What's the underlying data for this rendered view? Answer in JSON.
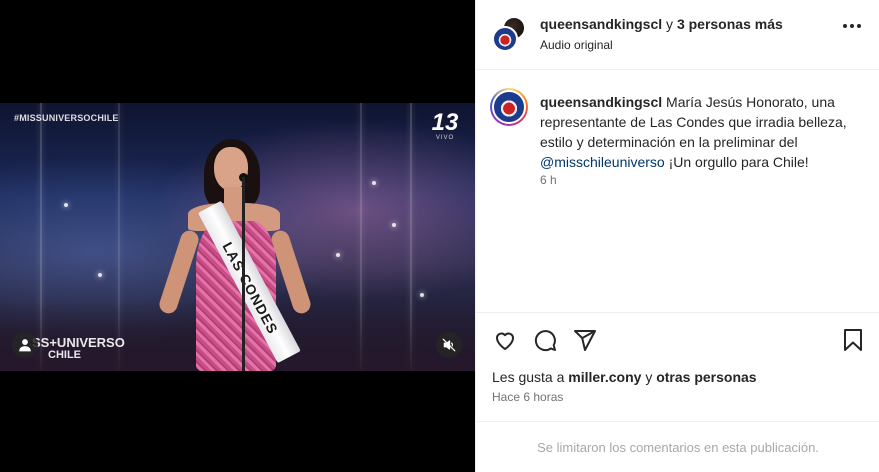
{
  "media": {
    "hashtag_overlay": "#MISSUNIVERSOCHILE",
    "channel_number": "13",
    "channel_sub": "VIVO",
    "brand_line1": "SS+UNIVERSO",
    "brand_line2": "CHILE",
    "sash_text": "LAS CONDES",
    "user_tag_icon": "person-icon",
    "mute_icon": "speaker-muted-icon"
  },
  "header": {
    "username": "queensandkingscl",
    "connector": " y ",
    "others": "3 personas más",
    "audio": "Audio original"
  },
  "caption": {
    "username": "queensandkingscl",
    "text_part1": " María Jesús Honorato, una representante de Las Condes que irradia belleza, estilo y determinación en la preliminar del ",
    "mention": "@misschileuniverso",
    "text_part2": " ¡Un orgullo para Chile!",
    "time": "6 h"
  },
  "actions": {
    "like_icon": "heart-icon",
    "comment_icon": "comment-icon",
    "share_icon": "send-icon",
    "save_icon": "bookmark-icon"
  },
  "likes": {
    "prefix": "Les gusta a ",
    "user": "miller.cony",
    "middle": " y ",
    "others": "otras personas"
  },
  "posted_ago": "Hace 6 horas",
  "comments_limited": "Se limitaron los comentarios en esta publicación.",
  "colors": {
    "text": "#262626",
    "muted": "#737373",
    "mention": "#00376b",
    "divider": "#efefef"
  }
}
